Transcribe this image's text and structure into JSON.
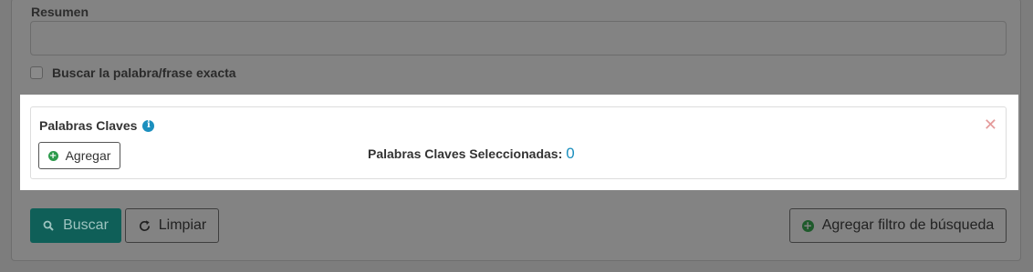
{
  "form": {
    "resumen_label": "Resumen",
    "resumen_value": "",
    "exact_label": "Buscar la palabra/frase exacta",
    "exact_checked": false
  },
  "keywords": {
    "title": "Palabras Claves",
    "info_icon": "info-icon",
    "close_icon": "close-icon",
    "close_glyph": "✕",
    "add_button_label": "Agregar",
    "selected_label": "Palabras Claves Seleccionadas:",
    "selected_count": "0"
  },
  "actions": {
    "search_label": "Buscar",
    "clear_label": "Limpiar",
    "add_filter_label": "Agregar filtro de búsqueda"
  },
  "colors": {
    "accent_teal": "#0f5f58",
    "info_blue": "#1b8fbe",
    "add_green": "#2c9a4b",
    "close_red": "#e49a9a"
  }
}
